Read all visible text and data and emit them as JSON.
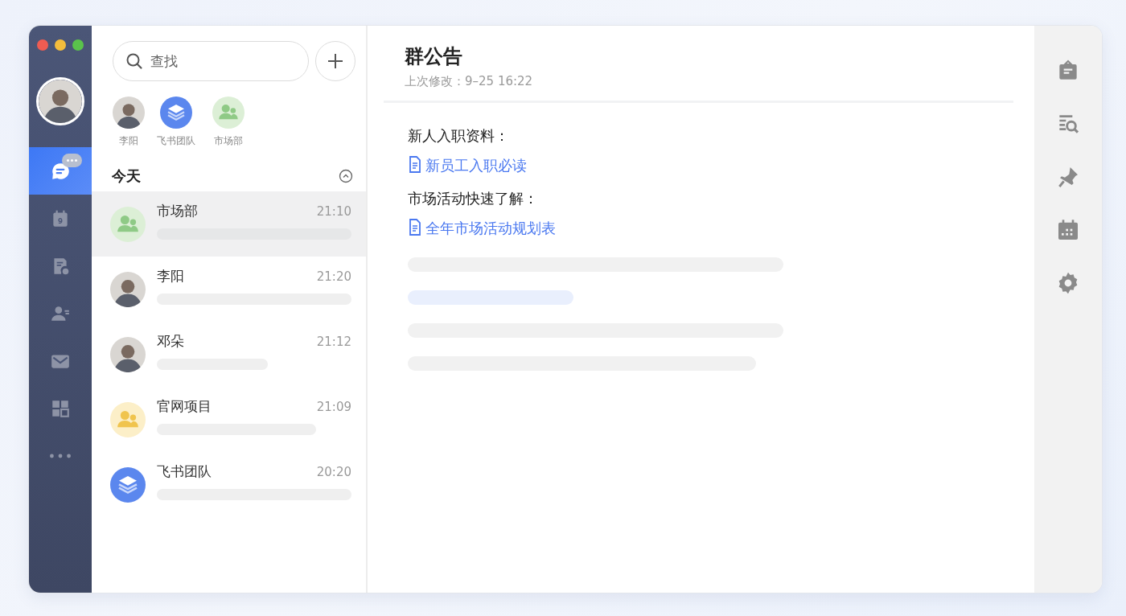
{
  "nav": {
    "avatar": {
      "kind": "person"
    },
    "items": [
      {
        "kind": "chat",
        "selected": true,
        "unread": true
      },
      {
        "kind": "calendar",
        "selected": false,
        "unread": false,
        "text": "9"
      },
      {
        "kind": "docs",
        "selected": false,
        "unread": false
      },
      {
        "kind": "contacts",
        "selected": false,
        "unread": false
      },
      {
        "kind": "mail",
        "selected": false,
        "unread": false
      },
      {
        "kind": "apps",
        "selected": false,
        "unread": false
      },
      {
        "kind": "more",
        "selected": false,
        "unread": false
      }
    ]
  },
  "chat_list": {
    "search": {
      "placeholder": "查找"
    },
    "pinned": [
      {
        "name": "李阳",
        "kind": "person"
      },
      {
        "name": "飞书团队",
        "kind": "team"
      },
      {
        "name": "市场部",
        "kind": "group-green"
      }
    ],
    "section": {
      "title": "今天",
      "expanded": true
    },
    "chats": [
      {
        "name": "市场部",
        "time": "21:10",
        "kind": "group-green",
        "selected": true
      },
      {
        "name": "李阳",
        "time": "21:20",
        "kind": "person",
        "selected": false
      },
      {
        "name": "邓朵",
        "time": "21:12",
        "kind": "person",
        "selected": false
      },
      {
        "name": "官网项目",
        "time": "21:09",
        "kind": "group-yellow",
        "selected": false
      },
      {
        "name": "飞书团队",
        "time": "20:20",
        "kind": "team",
        "selected": false
      }
    ]
  },
  "announcement": {
    "title": "群公告",
    "modified": "上次修改：9–25 16:22",
    "blocks": [
      {
        "kind": "text",
        "text": "新人入职资料："
      },
      {
        "kind": "link",
        "text": "新员工入职必读"
      },
      {
        "kind": "text",
        "text": "市场活动快速了解："
      },
      {
        "kind": "link",
        "text": "全年市场活动规划表"
      },
      {
        "kind": "skeleton"
      },
      {
        "kind": "skeleton-accent"
      },
      {
        "kind": "skeleton"
      },
      {
        "kind": "skeleton"
      }
    ]
  },
  "toolbar": [
    {
      "kind": "board"
    },
    {
      "kind": "search-list"
    },
    {
      "kind": "pin"
    },
    {
      "kind": "calendar"
    },
    {
      "kind": "settings"
    }
  ]
}
